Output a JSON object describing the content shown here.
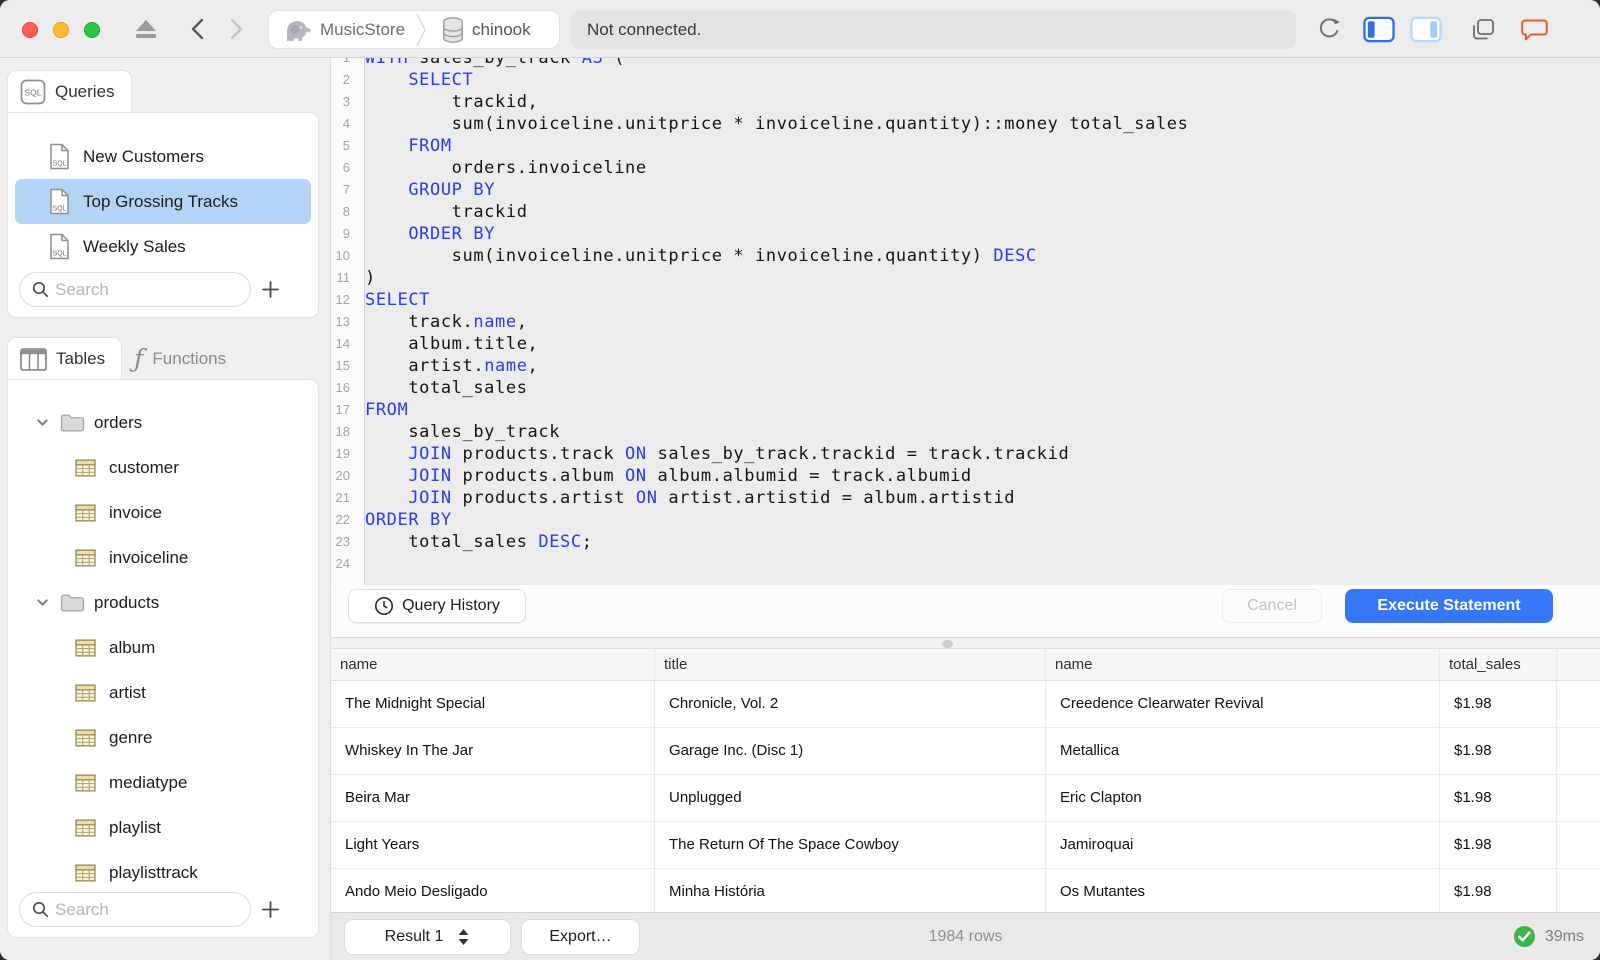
{
  "titlebar": {
    "breadcrumb": [
      {
        "icon": "postgres-elephant-icon",
        "label": "MusicStore"
      },
      {
        "icon": "database-icon",
        "label": "chinook"
      }
    ],
    "status_message": "Not connected.",
    "icons": [
      "eject-icon",
      "back-icon",
      "forward-icon",
      "refresh-icon",
      "toggle-left-sidebar-icon",
      "toggle-right-sidebar-icon",
      "windows-icon",
      "feedback-chat-icon"
    ]
  },
  "sidebar": {
    "queries": {
      "tab_label": "Queries",
      "items": [
        {
          "label": "New Customers",
          "selected": false
        },
        {
          "label": "Top Grossing Tracks",
          "selected": true
        },
        {
          "label": "Weekly Sales",
          "selected": false
        }
      ],
      "search_placeholder": "Search"
    },
    "schema": {
      "tabs": [
        {
          "label": "Tables",
          "selected": true
        },
        {
          "label": "Functions",
          "selected": false
        }
      ],
      "tree": [
        {
          "type": "folder",
          "label": "orders",
          "expanded": true,
          "children": [
            "customer",
            "invoice",
            "invoiceline"
          ]
        },
        {
          "type": "folder",
          "label": "products",
          "expanded": true,
          "children": [
            "album",
            "artist",
            "genre",
            "mediatype",
            "playlist",
            "playlisttrack"
          ]
        }
      ],
      "search_placeholder": "Search"
    }
  },
  "editor": {
    "lines": [
      {
        "n": 1,
        "segs": [
          [
            "WITH",
            "k"
          ],
          [
            " sales_by_track ",
            "p"
          ],
          [
            "AS",
            "k"
          ],
          [
            " (",
            "p"
          ]
        ]
      },
      {
        "n": 2,
        "segs": [
          [
            "    ",
            "p"
          ],
          [
            "SELECT",
            "k"
          ]
        ]
      },
      {
        "n": 3,
        "segs": [
          [
            "        trackid,",
            "p"
          ]
        ]
      },
      {
        "n": 4,
        "segs": [
          [
            "        sum(invoiceline.unitprice * invoiceline.quantity)::money total_sales",
            "p"
          ]
        ]
      },
      {
        "n": 5,
        "segs": [
          [
            "    ",
            "p"
          ],
          [
            "FROM",
            "k"
          ]
        ]
      },
      {
        "n": 6,
        "segs": [
          [
            "        orders.invoiceline",
            "p"
          ]
        ]
      },
      {
        "n": 7,
        "segs": [
          [
            "    ",
            "p"
          ],
          [
            "GROUP BY",
            "k"
          ]
        ]
      },
      {
        "n": 8,
        "segs": [
          [
            "        trackid",
            "p"
          ]
        ]
      },
      {
        "n": 9,
        "segs": [
          [
            "    ",
            "p"
          ],
          [
            "ORDER BY",
            "k"
          ]
        ]
      },
      {
        "n": 10,
        "segs": [
          [
            "        sum(invoiceline.unitprice * invoiceline.quantity) ",
            "p"
          ],
          [
            "DESC",
            "k"
          ]
        ]
      },
      {
        "n": 11,
        "segs": [
          [
            ")",
            "p"
          ]
        ]
      },
      {
        "n": 12,
        "segs": [
          [
            "SELECT",
            "k"
          ]
        ]
      },
      {
        "n": 13,
        "segs": [
          [
            "    track.",
            "p"
          ],
          [
            "name",
            "k"
          ],
          [
            ",",
            "p"
          ]
        ]
      },
      {
        "n": 14,
        "segs": [
          [
            "    album.title,",
            "p"
          ]
        ]
      },
      {
        "n": 15,
        "segs": [
          [
            "    artist.",
            "p"
          ],
          [
            "name",
            "k"
          ],
          [
            ",",
            "p"
          ]
        ]
      },
      {
        "n": 16,
        "segs": [
          [
            "    total_sales",
            "p"
          ]
        ]
      },
      {
        "n": 17,
        "segs": [
          [
            "FROM",
            "k"
          ]
        ]
      },
      {
        "n": 18,
        "segs": [
          [
            "    sales_by_track",
            "p"
          ]
        ]
      },
      {
        "n": 19,
        "segs": [
          [
            "    ",
            "p"
          ],
          [
            "JOIN",
            "k"
          ],
          [
            " products.track ",
            "p"
          ],
          [
            "ON",
            "k"
          ],
          [
            " sales_by_track.trackid = track.trackid",
            "p"
          ]
        ]
      },
      {
        "n": 20,
        "segs": [
          [
            "    ",
            "p"
          ],
          [
            "JOIN",
            "k"
          ],
          [
            " products.album ",
            "p"
          ],
          [
            "ON",
            "k"
          ],
          [
            " album.albumid = track.albumid",
            "p"
          ]
        ]
      },
      {
        "n": 21,
        "segs": [
          [
            "    ",
            "p"
          ],
          [
            "JOIN",
            "k"
          ],
          [
            " products.artist ",
            "p"
          ],
          [
            "ON",
            "k"
          ],
          [
            " artist.artistid = album.artistid",
            "p"
          ]
        ]
      },
      {
        "n": 22,
        "segs": [
          [
            "ORDER BY",
            "k"
          ]
        ]
      },
      {
        "n": 23,
        "segs": [
          [
            "    total_sales ",
            "p"
          ],
          [
            "DESC",
            "k"
          ],
          [
            ";",
            "p"
          ]
        ]
      },
      {
        "n": 24,
        "segs": [
          [
            "",
            "p"
          ]
        ]
      }
    ]
  },
  "actions": {
    "query_history": "Query History",
    "cancel": "Cancel",
    "execute": "Execute Statement"
  },
  "results": {
    "columns": [
      "name",
      "title",
      "name",
      "total_sales"
    ],
    "rows": [
      [
        "The Midnight Special",
        "Chronicle, Vol. 2",
        "Creedence Clearwater Revival",
        "$1.98"
      ],
      [
        "Whiskey In The Jar",
        "Garage Inc. (Disc 1)",
        "Metallica",
        "$1.98"
      ],
      [
        "Beira Mar",
        "Unplugged",
        "Eric Clapton",
        "$1.98"
      ],
      [
        "Light Years",
        "The Return Of The Space Cowboy",
        "Jamiroquai",
        "$1.98"
      ],
      [
        "Ando Meio Desligado",
        "Minha História",
        "Os Mutantes",
        "$1.98"
      ]
    ]
  },
  "statusbar": {
    "result_selector": "Result 1",
    "export_label": "Export…",
    "row_count": "1984 rows",
    "duration": "39ms"
  },
  "colors": {
    "accent_blue": "#3577f5",
    "selection_blue": "#b4d4f5",
    "keyword_blue": "#2b3be6",
    "success_green": "#3cb44a",
    "feedback_orange": "#e45a2e"
  }
}
